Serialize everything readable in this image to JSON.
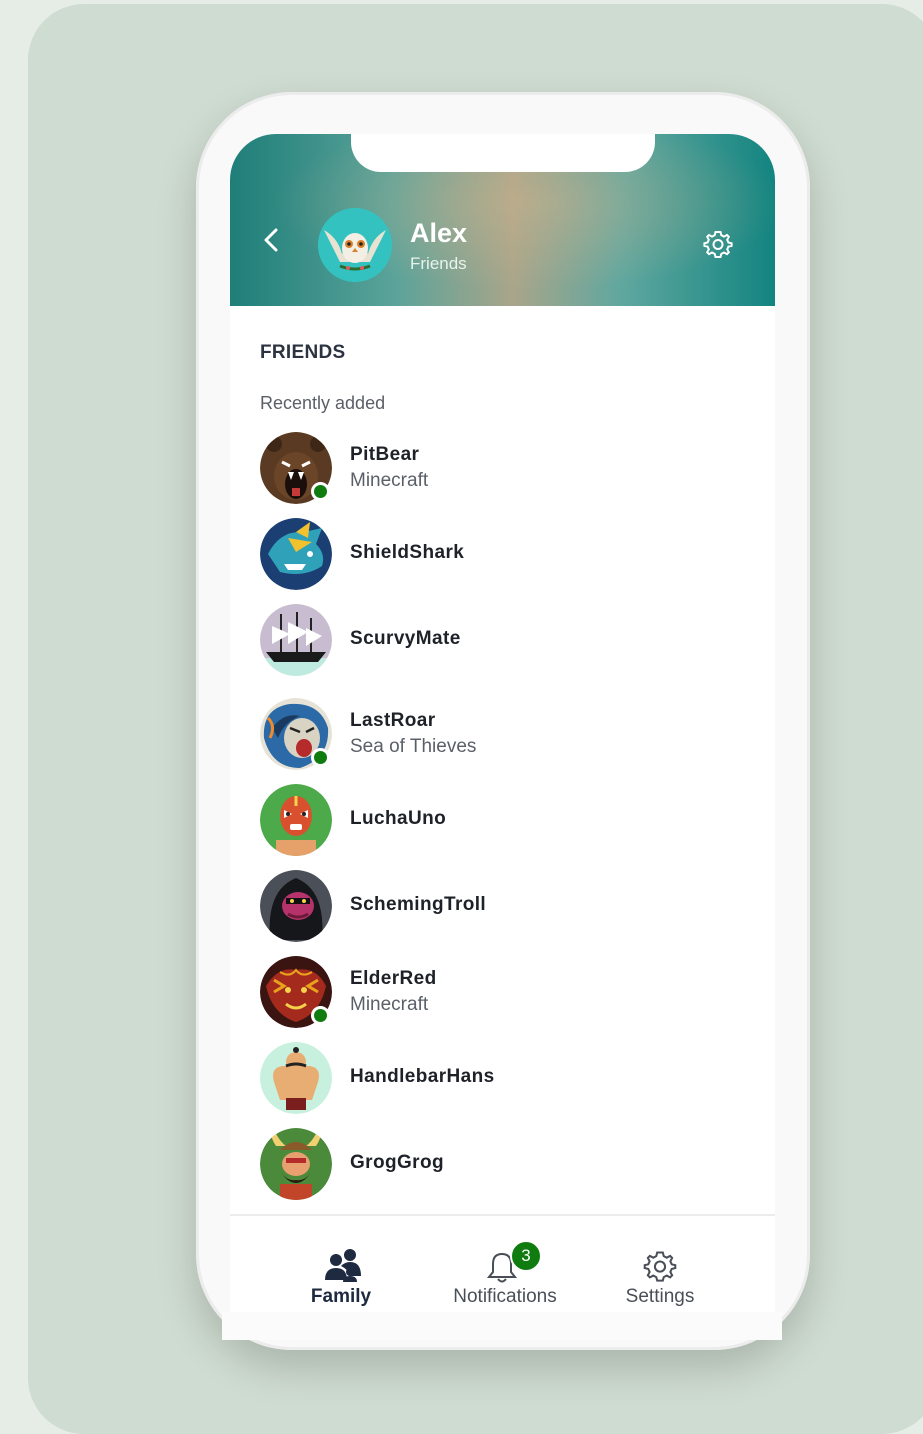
{
  "header": {
    "name": "Alex",
    "subtitle": "Friends",
    "avatar_icon": "owl-avatar",
    "back_icon": "chevron-left-icon",
    "settings_icon": "gear-icon"
  },
  "section_title": "FRIENDS",
  "subheader": "Recently added",
  "friends": [
    {
      "name": "PitBear",
      "game": "Minecraft",
      "online": true,
      "avatar": "bear-avatar"
    },
    {
      "name": "ShieldShark",
      "game": "",
      "online": false,
      "avatar": "shark-avatar"
    },
    {
      "name": "ScurvyMate",
      "game": "",
      "online": false,
      "avatar": "ship-avatar"
    },
    {
      "name": "LastRoar",
      "game": "Sea of Thieves",
      "online": true,
      "avatar": "lion-avatar"
    },
    {
      "name": "LuchaUno",
      "game": "",
      "online": false,
      "avatar": "wrestler-avatar"
    },
    {
      "name": "SchemingTroll",
      "game": "",
      "online": false,
      "avatar": "troll-avatar"
    },
    {
      "name": "ElderRed",
      "game": "Minecraft",
      "online": true,
      "avatar": "dragon-avatar"
    },
    {
      "name": "HandlebarHans",
      "game": "",
      "online": false,
      "avatar": "strongman-avatar"
    },
    {
      "name": "GrogGrog",
      "game": "",
      "online": false,
      "avatar": "viking-avatar"
    }
  ],
  "tabs": [
    {
      "label": "Family",
      "icon": "family-icon",
      "active": true
    },
    {
      "label": "Notifications",
      "icon": "bell-icon",
      "badge": "3"
    },
    {
      "label": "Settings",
      "icon": "gear-icon"
    }
  ],
  "colors": {
    "online": "#107c10",
    "header_teal": "#1f7e79",
    "background": "#cfdcd1"
  }
}
